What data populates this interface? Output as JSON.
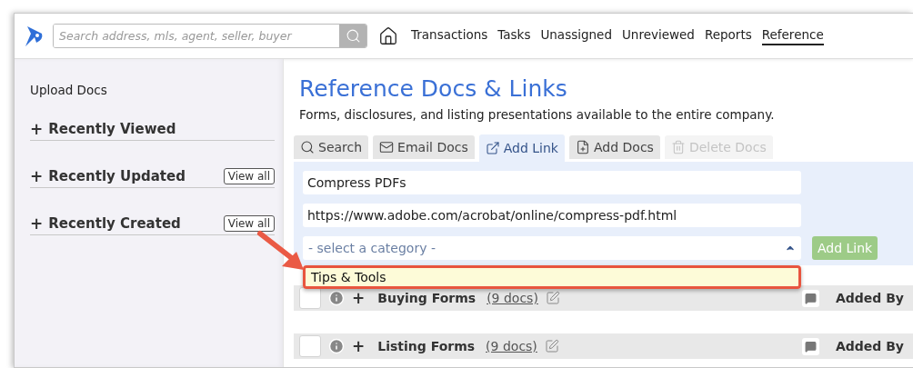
{
  "header": {
    "search": {
      "placeholder": "Search address, mls, agent, seller, buyer"
    },
    "nav": [
      {
        "label": "Transactions",
        "selected": false
      },
      {
        "label": "Tasks",
        "selected": false
      },
      {
        "label": "Unassigned",
        "selected": false
      },
      {
        "label": "Unreviewed",
        "selected": false
      },
      {
        "label": "Reports",
        "selected": false
      },
      {
        "label": "Reference",
        "selected": true
      }
    ]
  },
  "sidebar": {
    "upload": "Upload Docs",
    "sections": [
      {
        "expander": "+",
        "title": "Recently Viewed"
      },
      {
        "expander": "+",
        "title": "Recently Updated",
        "button": "View all"
      },
      {
        "expander": "+",
        "title": "Recently Created",
        "button": "View all"
      }
    ]
  },
  "main": {
    "title": "Reference Docs & Links",
    "subtitle": "Forms, disclosures, and listing presentations available to the entire company.",
    "tabs": [
      {
        "kind": "search",
        "label": "Search",
        "selected": false,
        "disabled": false
      },
      {
        "kind": "email",
        "label": "Email Docs",
        "selected": false,
        "disabled": false
      },
      {
        "kind": "link",
        "label": "Add Link",
        "selected": true,
        "disabled": false
      },
      {
        "kind": "doc",
        "label": "Add Docs",
        "selected": false,
        "disabled": false
      },
      {
        "kind": "trash",
        "label": "Delete Docs",
        "selected": false,
        "disabled": true
      }
    ],
    "form": {
      "name_value": "Compress PDFs",
      "url_value": "https://www.adobe.com/acrobat/online/compress-pdf.html",
      "category_placeholder": "- select a category -",
      "submit": "Add Link",
      "dropdown": [
        {
          "label": "Tips & Tools",
          "selected": true
        }
      ]
    },
    "groups": [
      {
        "expander": "+",
        "title": "Buying Forms",
        "count": "(9 docs)",
        "added_by": "Added By",
        "checked": false
      },
      {
        "expander": "+",
        "title": "Listing Forms",
        "count": "(9 docs)",
        "added_by": "Added By",
        "checked": false
      }
    ]
  }
}
